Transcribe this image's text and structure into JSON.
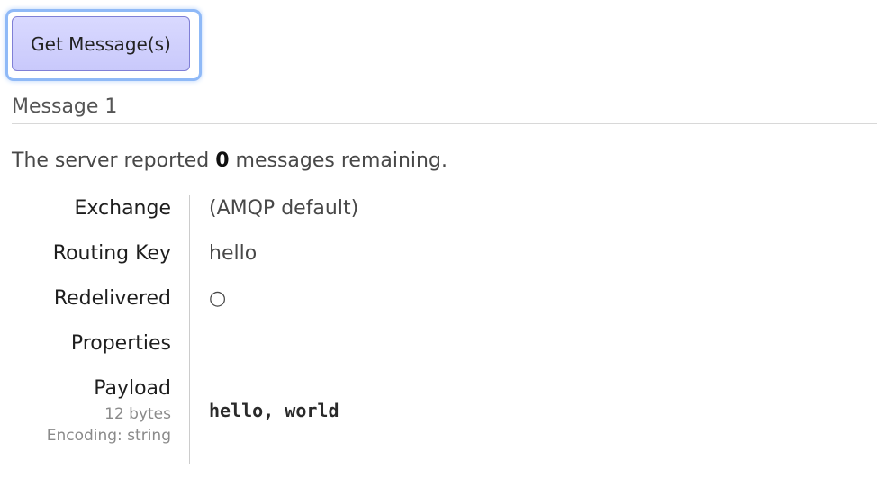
{
  "button": {
    "label": "Get Message(s)"
  },
  "message": {
    "heading": "Message 1",
    "server_prefix": "The server reported ",
    "remaining_count": "0",
    "server_suffix": " messages remaining."
  },
  "fields": {
    "exchange_label": "Exchange",
    "exchange_value": "(AMQP default)",
    "routing_key_label": "Routing Key",
    "routing_key_value": "hello",
    "redelivered_label": "Redelivered",
    "redelivered_value": "○",
    "properties_label": "Properties",
    "properties_value": "",
    "payload_label": "Payload",
    "payload_size": "12 bytes",
    "payload_encoding": "Encoding: string",
    "payload_value": "hello, world"
  },
  "colors": {
    "button_bg": "#d9d9ff",
    "button_border": "#7f7fd6",
    "focus_ring": "#8fb9f7"
  }
}
